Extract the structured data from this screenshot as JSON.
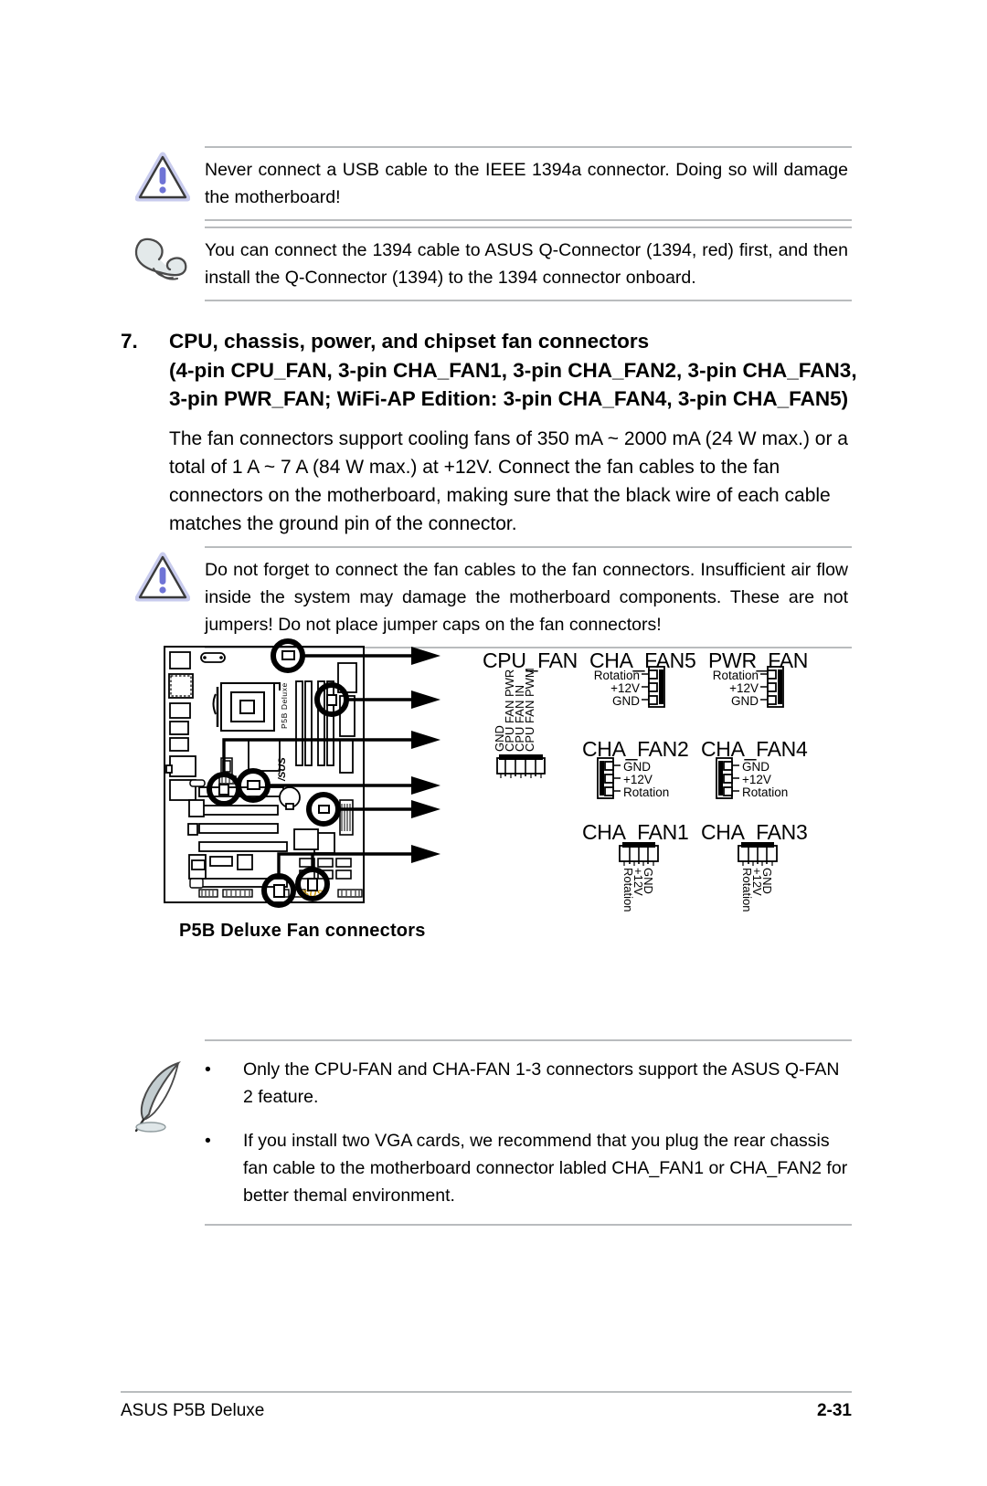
{
  "notes": {
    "warning_usb": {
      "icon": "warning-triangle-icon",
      "text": "Never connect a USB cable to the IEEE 1394a connector. Doing so will damage the motherboard!"
    },
    "tip_1394": {
      "icon": "pointing-hand-icon",
      "text": "You can connect the 1394 cable to ASUS Q-Connector (1394, red) first, and then install the Q-Connector (1394) to the 1394 connector onboard."
    },
    "warning_fan": {
      "icon": "warning-triangle-icon",
      "text": "Do not forget to connect the fan cables to the fan connectors. Insufficient air flow inside the system may damage the motherboard components. These are not jumpers! Do not place jumper caps on the fan connectors!"
    },
    "bottom_note": {
      "icon": "feather-quill-icon",
      "bullet": "•",
      "items": [
        "Only the CPU-FAN and CHA-FAN 1-3 connectors support the ASUS Q-FAN 2 feature.",
        "If you install two VGA cards, we recommend that you plug the rear chassis fan cable to the motherboard connector labled CHA_FAN1 or CHA_FAN2 for better themal environment."
      ]
    }
  },
  "section": {
    "number": "7.",
    "title_lines": [
      "CPU, chassis, power, and chipset fan connectors",
      "(4-pin CPU_FAN, 3-pin CHA_FAN1, 3-pin CHA_FAN2, 3-pin CHA_FAN3,",
      "3-pin PWR_FAN; WiFi-AP Edition: 3-pin CHA_FAN4, 3-pin CHA_FAN5)"
    ],
    "paragraph": "The fan connectors support cooling fans of 350 mA ~ 2000 mA (24 W max.) or a total of 1 A ~ 7 A (84 W max.) at +12V. Connect the fan cables to the fan connectors on the motherboard, making sure that the black wire of each cable matches the ground pin of the connector."
  },
  "diagram": {
    "caption": "P5B Deluxe Fan connectors",
    "board_silk": "P5B Deluxe",
    "board_brand": "/SUS",
    "connectors": [
      {
        "name": "CPU_FAN",
        "pins": [
          "GND",
          "CPU FAN PWR",
          "CPU FAN IN",
          "CPU FAN PWM"
        ],
        "pin_count": 4,
        "label_orientation": "vertical-up"
      },
      {
        "name": "CHA_FAN5",
        "pins": [
          "Rotation",
          "+12V",
          "GND"
        ],
        "pin_count": 3,
        "label_orientation": "horizontal-left"
      },
      {
        "name": "PWR_FAN",
        "pins": [
          "Rotation",
          "+12V",
          "GND"
        ],
        "pin_count": 3,
        "label_orientation": "horizontal-left"
      },
      {
        "name": "CHA_FAN2",
        "pins": [
          "GND",
          "+12V",
          "Rotation"
        ],
        "pin_count": 3,
        "label_orientation": "horizontal-right"
      },
      {
        "name": "CHA_FAN4",
        "pins": [
          "GND",
          "+12V",
          "Rotation"
        ],
        "pin_count": 3,
        "label_orientation": "horizontal-right"
      },
      {
        "name": "CHA_FAN1",
        "pins": [
          "Rotation",
          "+12V",
          "GND"
        ],
        "pin_count": 3,
        "label_orientation": "vertical-down"
      },
      {
        "name": "CHA_FAN3",
        "pins": [
          "Rotation",
          "+12V",
          "GND"
        ],
        "pin_count": 3,
        "label_orientation": "vertical-down"
      }
    ]
  },
  "footer": {
    "left": "ASUS P5B Deluxe",
    "page": "2-31"
  },
  "colors": {
    "rule": "#b9bcbe",
    "warning_icon": "#6f74d6",
    "tip_icon": "#d8dee0",
    "board_line": "#000000",
    "brand_gold": "#d4a017"
  }
}
